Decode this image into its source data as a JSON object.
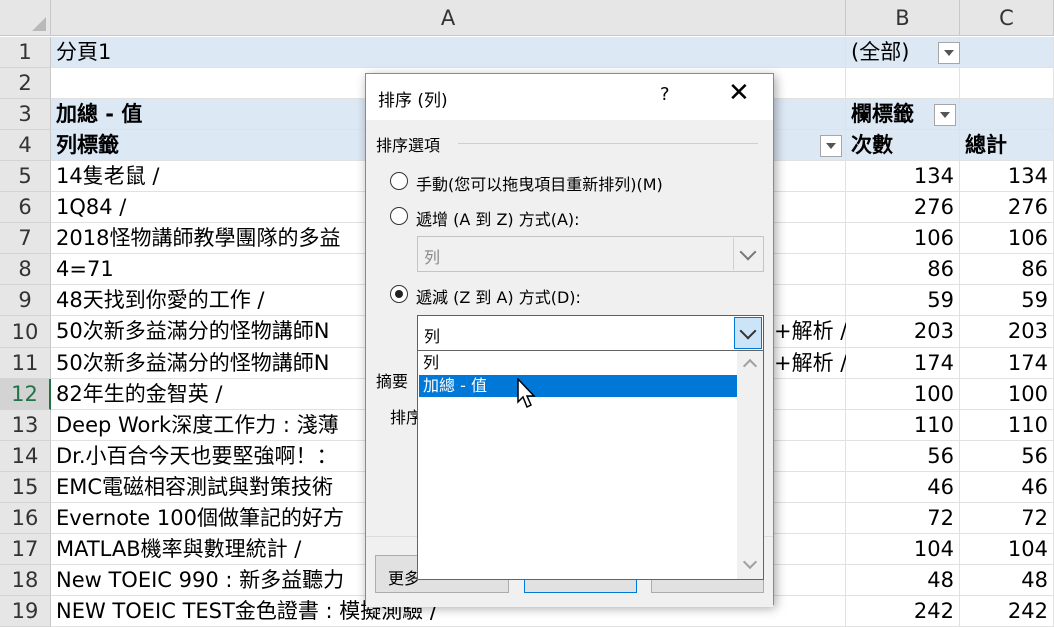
{
  "sheet": {
    "columns": [
      "A",
      "B",
      "C"
    ],
    "filter_label": "分頁1",
    "filter_value": "(全部)",
    "values_header": "加總 - 值",
    "row_labels_header": "列標籤",
    "col_labels_header": "欄標籤",
    "count_header": "次數",
    "total_header": "總計",
    "rows": [
      {
        "n": "1"
      },
      {
        "n": "2"
      },
      {
        "n": "3"
      },
      {
        "n": "4"
      },
      {
        "n": "5",
        "label": "14隻老鼠 /",
        "b": "134",
        "c": "134"
      },
      {
        "n": "6",
        "label": "1Q84 /",
        "b": "276",
        "c": "276"
      },
      {
        "n": "7",
        "label": "2018怪物講師教學團隊的多益",
        "b": "106",
        "c": "106"
      },
      {
        "n": "8",
        "label": "4=71",
        "b": "86",
        "c": "86"
      },
      {
        "n": "9",
        "label": "48天找到你愛的工作 /",
        "b": "59",
        "c": "59"
      },
      {
        "n": "10",
        "label": "50次新多益滿分的怪物講師N",
        "tail": "+解析 /",
        "b": "203",
        "c": "203"
      },
      {
        "n": "11",
        "label": "50次新多益滿分的怪物講師N",
        "tail": "+解析 /",
        "b": "174",
        "c": "174"
      },
      {
        "n": "12",
        "label": "82年生的金智英 /",
        "b": "100",
        "c": "100"
      },
      {
        "n": "13",
        "label": "Deep Work深度工作力 : 淺薄",
        "b": "110",
        "c": "110"
      },
      {
        "n": "14",
        "label": "Dr.小百合今天也要堅強啊！：",
        "b": "56",
        "c": "56"
      },
      {
        "n": "15",
        "label": "EMC電磁相容測試與對策技術",
        "b": "46",
        "c": "46"
      },
      {
        "n": "16",
        "label": "Evernote 100個做筆記的好方",
        "b": "72",
        "c": "72"
      },
      {
        "n": "17",
        "label": "MATLAB機率與數理統計 /",
        "b": "104",
        "c": "104"
      },
      {
        "n": "18",
        "label": "New TOEIC 990 : 新多益聽力",
        "b": "48",
        "c": "48"
      },
      {
        "n": "19",
        "label": "NEW TOEIC TEST金色證書 : 模擬測驗 /",
        "b": "242",
        "c": "242"
      }
    ]
  },
  "dialog": {
    "title": "排序 (列)",
    "help": "?",
    "close": "✕",
    "group_label": "排序選項",
    "option_manual": "手動(您可以拖曳項目重新排列)(M)",
    "option_asc": "遞增 (A 到 Z) 方式(A):",
    "asc_value": "列",
    "option_desc": "遞減 (Z 到 A) 方式(D):",
    "desc_value": "列",
    "list_items": [
      "列",
      "加總 - 值"
    ],
    "summary_label": "摘要",
    "sort_label": "排序",
    "more_button": "更多"
  }
}
